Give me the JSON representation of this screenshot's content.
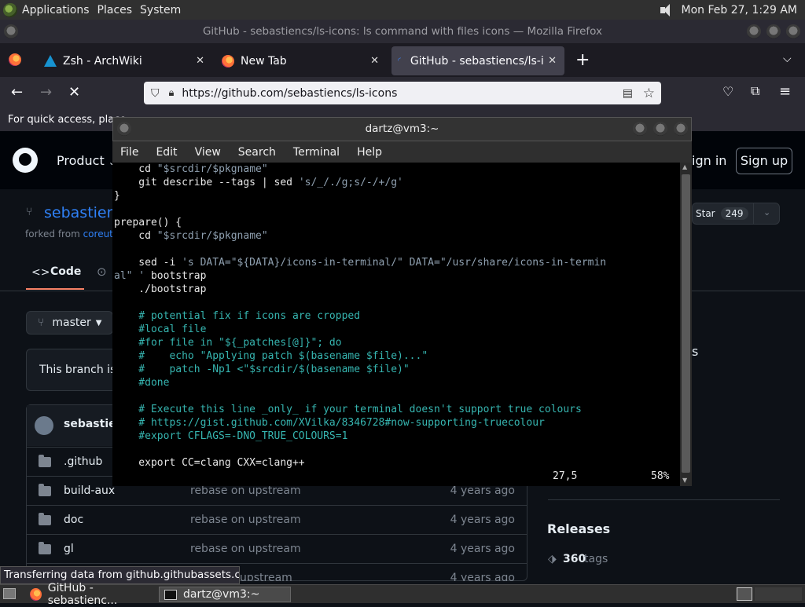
{
  "top_panel": {
    "menus": [
      "Applications",
      "Places",
      "System"
    ],
    "clock": "Mon Feb 27,  1:29 AM"
  },
  "firefox": {
    "window_title": "GitHub - sebastiencs/ls-icons: ls command with files icons — Mozilla Firefox",
    "tabs": [
      {
        "label": "Zsh - ArchWiki"
      },
      {
        "label": "New Tab"
      },
      {
        "label": "GitHub - sebastiencs/ls-icon"
      }
    ],
    "url": "https://github.com/sebastiencs/ls-icons",
    "bookmarks_text": "For quick access, place",
    "status_text": "Transferring data from github.githubassets.com..."
  },
  "github": {
    "nav_product": "Product",
    "sign_in": "ign in",
    "sign_up": "Sign up",
    "repo_owner": "sebastien",
    "forked_prefix": "forked from ",
    "forked_link": "coreutils",
    "star_label": "Star",
    "star_count": "249",
    "code_tab": "Code",
    "branch": "master",
    "branch_notice": "This branch is",
    "avatar_user": "sebastien",
    "side_partial": "s",
    "releases_heading": "Releases",
    "tags_count": "360",
    "tags_label": "tags",
    "files": [
      {
        "name": ".github",
        "message": "",
        "age": ""
      },
      {
        "name": "build-aux",
        "message": "rebase on upstream",
        "age": "4 years ago"
      },
      {
        "name": "doc",
        "message": "rebase on upstream",
        "age": "4 years ago"
      },
      {
        "name": "gl",
        "message": "rebase on upstream",
        "age": "4 years ago"
      },
      {
        "name": "",
        "message": "upstream",
        "age": "4 years ago"
      }
    ]
  },
  "terminal": {
    "title": "dartz@vm3:~",
    "menu": [
      "File",
      "Edit",
      "View",
      "Search",
      "Terminal",
      "Help"
    ],
    "lines": [
      {
        "a": "    cd ",
        "s": "\"$srcdir/$pkgname\"",
        "b": "",
        "c": ""
      },
      {
        "a": "    git describe --tags | sed ",
        "s": "'s/_/./g;s/-/+/g'",
        "b": "",
        "c": ""
      },
      {
        "a": "}",
        "s": "",
        "b": "",
        "c": ""
      },
      {
        "a": "",
        "s": "",
        "b": "",
        "c": ""
      },
      {
        "a": "prepare() {",
        "s": "",
        "b": "",
        "c": ""
      },
      {
        "a": "    cd ",
        "s": "\"$srcdir/$pkgname\"",
        "b": "",
        "c": ""
      },
      {
        "a": "",
        "s": "",
        "b": "",
        "c": ""
      },
      {
        "a": "    sed -i ",
        "s": "'s DATA=\"${DATA}/icons-in-terminal/\" DATA=\"/usr/share/icons-in-termin",
        "b": "",
        "c": ""
      },
      {
        "a": "",
        "s": "al\" '",
        "b": " bootstrap",
        "c": ""
      },
      {
        "a": "    ./bootstrap",
        "s": "",
        "b": "",
        "c": ""
      },
      {
        "a": "",
        "s": "",
        "b": "",
        "c": ""
      },
      {
        "a": "",
        "s": "",
        "b": "",
        "c": "    # potential fix if icons are cropped"
      },
      {
        "a": "",
        "s": "",
        "b": "",
        "c": "    #local file"
      },
      {
        "a": "",
        "s": "",
        "b": "",
        "c": "    #for file in \"${_patches[@]}\"; do"
      },
      {
        "a": "",
        "s": "",
        "b": "",
        "c": "    #    echo \"Applying patch $(basename $file)...\""
      },
      {
        "a": "",
        "s": "",
        "b": "",
        "c": "    #    patch -Np1 <\"$srcdir/$(basename $file)\""
      },
      {
        "a": "",
        "s": "",
        "b": "",
        "c": "    #done"
      },
      {
        "a": "",
        "s": "",
        "b": "",
        "c": ""
      },
      {
        "a": "",
        "s": "",
        "b": "",
        "c": "    # Execute this line _only_ if your terminal doesn't support true colours"
      },
      {
        "a": "",
        "s": "",
        "b": "",
        "c": "    # https://gist.github.com/XVilka/8346728#now-supporting-truecolour"
      },
      {
        "a": "",
        "s": "",
        "b": "",
        "c": "    #export CFLAGS=-DNO_TRUE_COLOURS=1"
      },
      {
        "a": "",
        "s": "",
        "b": "",
        "c": ""
      },
      {
        "a": "    export CC=clang CXX=clang++",
        "s": "",
        "b": "",
        "c": ""
      }
    ],
    "cursor_pos": "27,5",
    "scroll_percent": "58%"
  },
  "taskbar": {
    "tasks": [
      {
        "label": "GitHub - sebastienc..."
      },
      {
        "label": "dartz@vm3:~"
      }
    ]
  }
}
